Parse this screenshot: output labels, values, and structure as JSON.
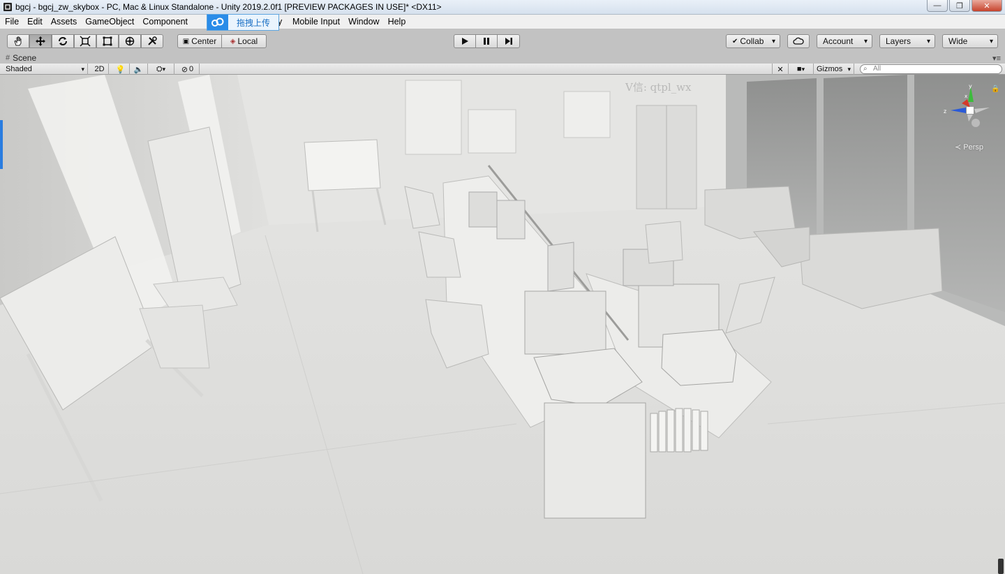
{
  "window": {
    "title": "bgcj - bgcj_zw_skybox - PC, Mac & Linux Standalone - Unity 2019.2.0f1 [PREVIEW PACKAGES IN USE]* <DX11>",
    "minimize": "—",
    "maximize": "❐",
    "close": "✕"
  },
  "menu": {
    "items": [
      "File",
      "Edit",
      "Assets",
      "GameObject",
      "Component"
    ],
    "hidden_tail": "y",
    "items_after": [
      "Mobile Input",
      "Window",
      "Help"
    ],
    "upload_label": "拖拽上传"
  },
  "toolbar": {
    "tools": [
      "hand-tool",
      "move-tool",
      "rotate-tool",
      "scale-tool",
      "rect-tool",
      "transform-tool",
      "custom-tool"
    ],
    "active_tool": "move-tool",
    "pivot": "Center",
    "space": "Local",
    "collab": "Collab",
    "account": "Account",
    "layers": "Layers",
    "layout": "Wide"
  },
  "scene": {
    "tab_label": "Scene",
    "shading_mode": "Shaded",
    "mode_2d": "2D",
    "hidden_count": "0",
    "gizmos": "Gizmos",
    "search_placeholder": "All",
    "persp_label": "Persp",
    "watermark": "V信: qtpl_wx"
  }
}
